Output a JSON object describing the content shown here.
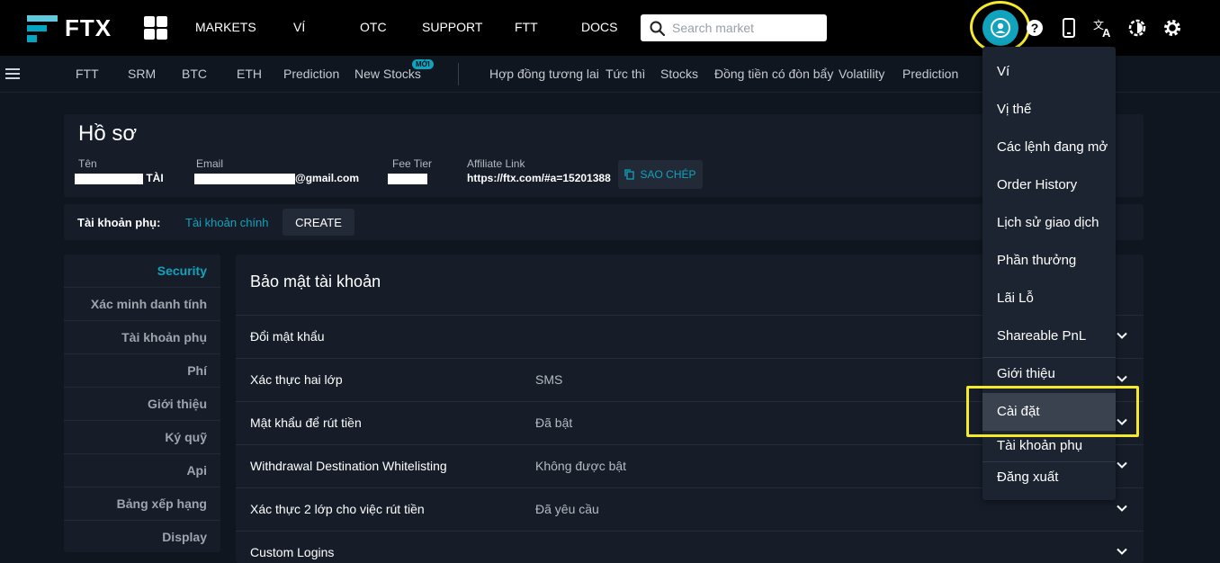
{
  "brand": {
    "logo_text": "FTX",
    "accent": "#11a3bd",
    "highlight": "#f4ea2a"
  },
  "topnav": {
    "items": [
      "MARKETS",
      "VÍ",
      "OTC",
      "SUPPORT",
      "FTT",
      "DOCS"
    ],
    "search_placeholder": "Search market"
  },
  "subnav": {
    "items": [
      "FTT",
      "SRM",
      "BTC",
      "ETH",
      "Prediction",
      "New Stocks",
      "Hợp đồng tương lai",
      "Tức thì",
      "Stocks",
      "Đồng tiền có đòn bẩy",
      "Volatility",
      "Prediction"
    ],
    "new_badge": "MỚI"
  },
  "profile": {
    "title": "Hồ sơ",
    "name_label": "Tên",
    "name_value": "TÀI",
    "email_label": "Email",
    "email_value": "@gmail.com",
    "fee_label": "Fee Tier",
    "affiliate_label": "Affiliate Link",
    "affiliate_value": "https://ftx.com/#a=15201388",
    "copy_label": "SAO CHÉP"
  },
  "subaccount": {
    "label": "Tài khoản phụ:",
    "main": "Tài khoản chính",
    "create": "CREATE"
  },
  "side_menu": {
    "items": [
      "Security",
      "Xác minh danh tính",
      "Tài khoản phụ",
      "Phí",
      "Giới thiệu",
      "Ký quỹ",
      "Api",
      "Bảng xếp hạng",
      "Display"
    ],
    "active": "Security"
  },
  "security": {
    "title": "Bảo mật tài khoản",
    "rows": [
      {
        "label": "Đổi mật khẩu",
        "value": ""
      },
      {
        "label": "Xác thực hai lớp",
        "value": "SMS"
      },
      {
        "label": "Mật khẩu để rút tiền",
        "value": "Đã bật"
      },
      {
        "label": "Withdrawal Destination Whitelisting",
        "value": "Không được bật"
      },
      {
        "label": "Xác thực 2 lớp cho việc rút tiền",
        "value": "Đã yêu cầu"
      },
      {
        "label": "Custom Logins",
        "value": ""
      }
    ]
  },
  "account_menu": {
    "items": [
      "Ví",
      "Vị thế",
      "Các lệnh đang mở",
      "Order History",
      "Lịch sử giao dịch",
      "Phần thưởng",
      "Lãi Lỗ",
      "Shareable PnL",
      "Giới thiệu",
      "Cài đặt",
      "Tài khoản phụ",
      "Đăng xuất"
    ],
    "selected": "Cài đặt"
  }
}
